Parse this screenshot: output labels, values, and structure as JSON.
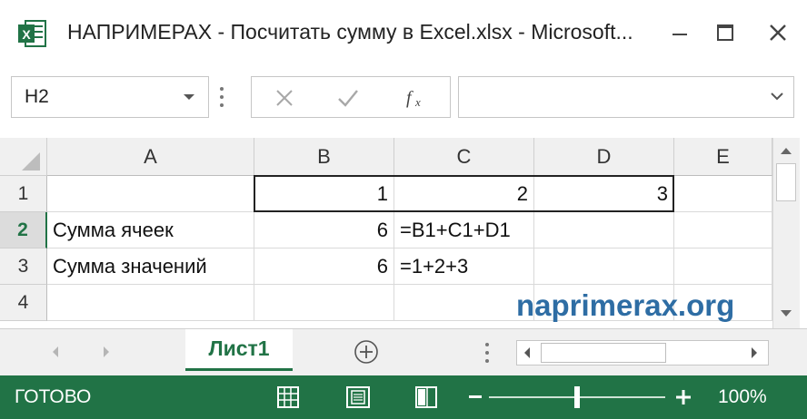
{
  "window": {
    "title": "НАПРИМЕРАХ - Посчитать сумму в Excel.xlsx - Microsoft...",
    "app_icon": "excel-icon"
  },
  "formula_bar": {
    "name_box": "H2",
    "formula": ""
  },
  "sheet": {
    "columns": [
      "A",
      "B",
      "C",
      "D",
      "E"
    ],
    "rows": [
      "1",
      "2",
      "3",
      "4"
    ],
    "active_row": "2",
    "cells": {
      "B1": "1",
      "C1": "2",
      "D1": "3",
      "A2": "Сумма ячеек",
      "B2": "6",
      "C2": "=B1+C1+D1",
      "A3": "Сумма значений",
      "B3": "6",
      "C3": "=1+2+3"
    }
  },
  "watermark": "naprimerax.org",
  "tabs": {
    "active": "Лист1"
  },
  "status": {
    "text": "ГОТОВО",
    "zoom": "100%"
  },
  "colors": {
    "excel_green": "#217346",
    "watermark_blue": "#2e6da4"
  }
}
